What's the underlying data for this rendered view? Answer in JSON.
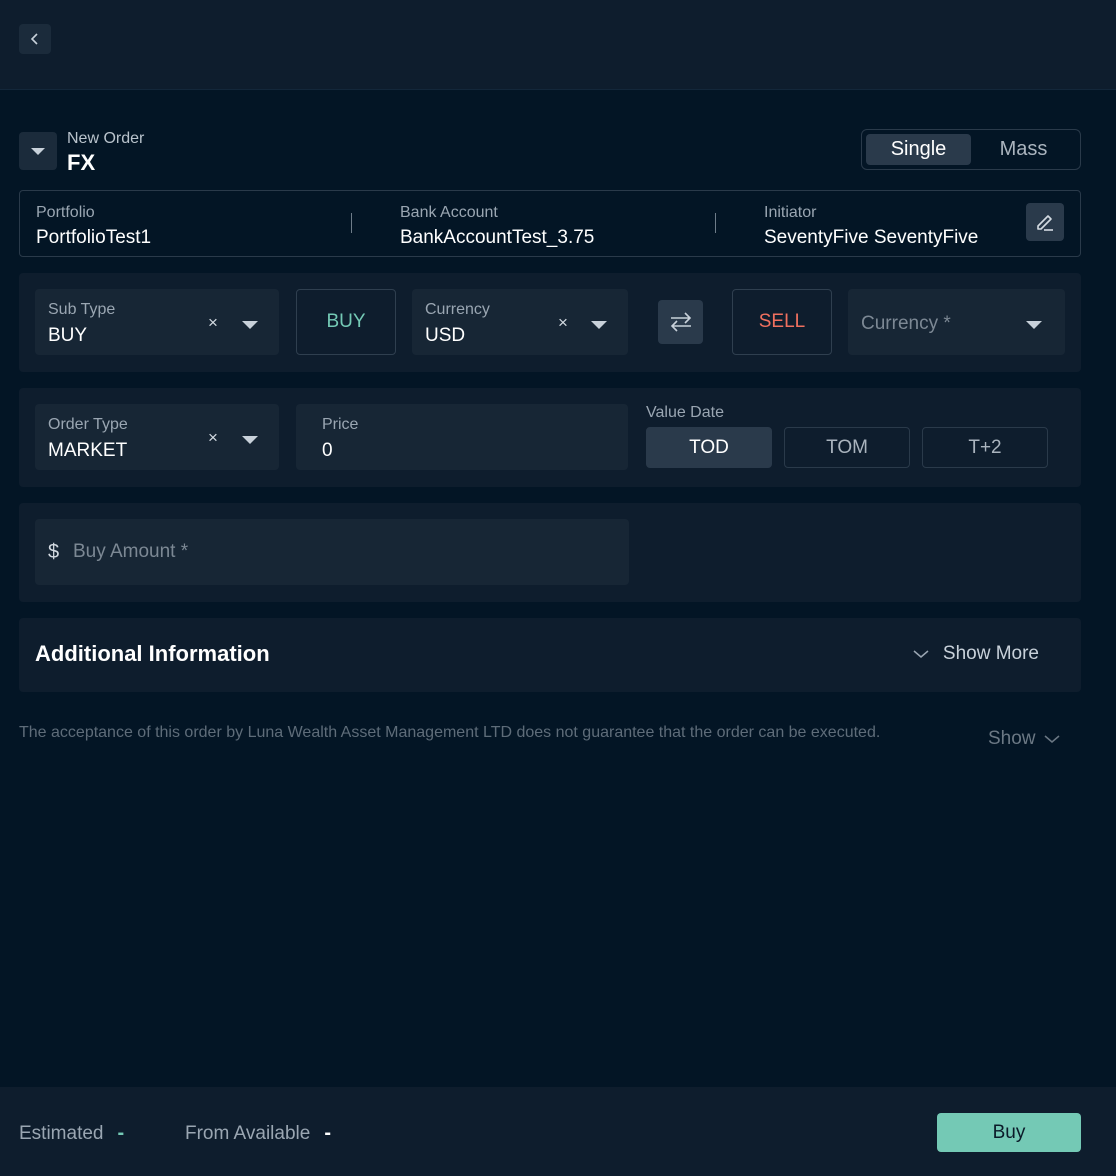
{
  "header": {
    "subtitle": "New Order",
    "title": "FX",
    "mode_tabs": [
      "Single",
      "Mass"
    ],
    "active_mode": "Single"
  },
  "info": {
    "portfolio_label": "Portfolio",
    "portfolio_value": "PortfolioTest1",
    "bank_label": "Bank Account",
    "bank_value": "BankAccountTest_3.75",
    "initiator_label": "Initiator",
    "initiator_value": "SeventyFive SeventyFive"
  },
  "trade": {
    "subtype_label": "Sub Type",
    "subtype_value": "BUY",
    "clear_glyph": "×",
    "buy_label": "BUY",
    "buy_currency_label": "Currency",
    "buy_currency_value": "USD",
    "sell_label": "SELL",
    "sell_currency_placeholder": "Currency *",
    "buy_color": "#74c9b5",
    "sell_color": "#f0705f"
  },
  "order": {
    "type_label": "Order Type",
    "type_value": "MARKET",
    "price_label": "Price",
    "price_value": "0",
    "value_date_label": "Value Date",
    "value_dates": [
      "TOD",
      "TOM",
      "T+2"
    ],
    "active_value_date": "TOD"
  },
  "amount": {
    "currency_symbol": "$",
    "placeholder": "Buy Amount *"
  },
  "additional": {
    "title": "Additional Information",
    "show_more": "Show More"
  },
  "disclaimer": {
    "text": "The acceptance of this order by Luna Wealth Asset Management LTD does not guarantee that the order can be executed.",
    "toggle": "Show"
  },
  "footer": {
    "estimated_label": "Estimated",
    "estimated_value": "-",
    "available_label": "From Available",
    "available_value": "-",
    "submit_label": "Buy"
  },
  "icons": {
    "back": "chevron-left-icon",
    "collapse": "caret-down-icon",
    "edit": "pencil-icon",
    "swap": "swap-arrows-icon"
  }
}
